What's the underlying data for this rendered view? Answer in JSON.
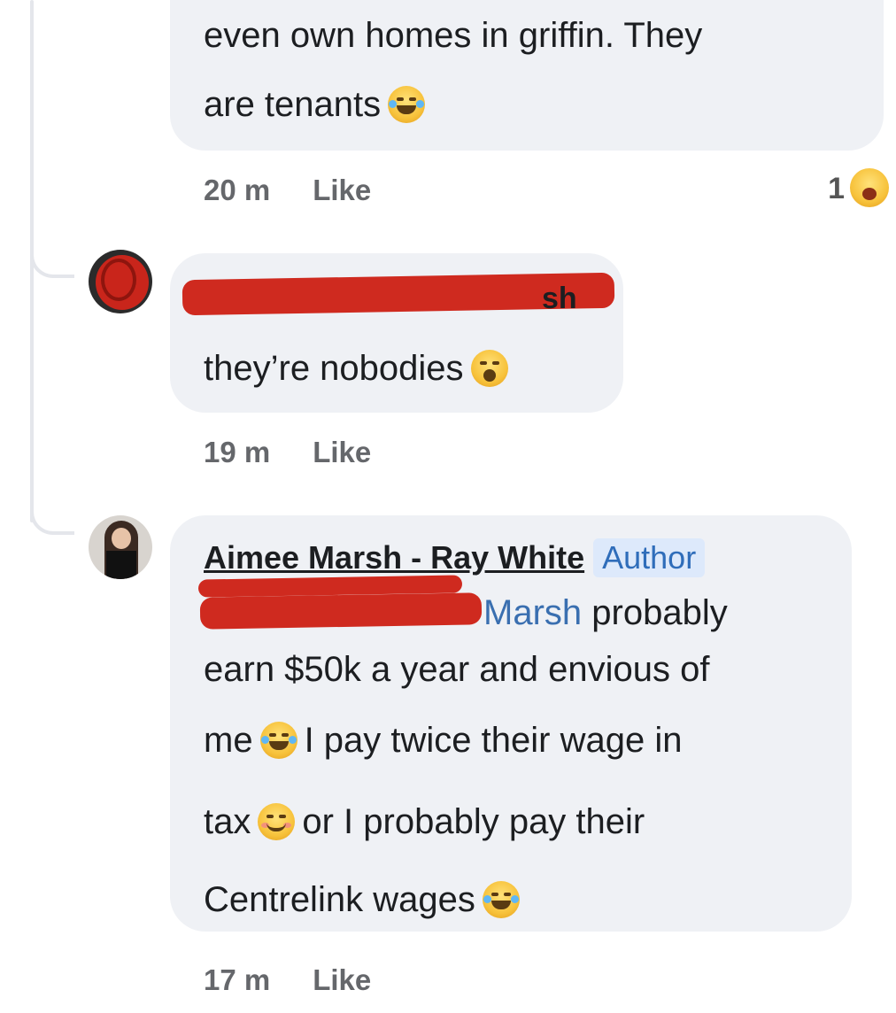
{
  "comment1": {
    "lines": [
      "even own homes in griffin. They",
      "are tenants"
    ],
    "emoji": "laughing-tears-emoji",
    "time": "20 m",
    "like_label": "Like",
    "reaction_count": "1",
    "reaction_emoji": "wow-emoji"
  },
  "comment2": {
    "author_partial": "sh",
    "text": "they’re nobodies",
    "emoji": "yawn-emoji",
    "time": "19 m",
    "like_label": "Like"
  },
  "comment3": {
    "author": "Aimee Marsh - Ray White",
    "badge": "Author",
    "mention": "Marsh",
    "line1_rest": "probably",
    "line2": "earn $50k a year and envious of",
    "line3_a": "me",
    "line3_b": "I pay twice their wage in",
    "line4_a": "tax",
    "line4_b": "or I probably pay their",
    "line5": "Centrelink wages",
    "time": "17 m",
    "like_label": "Like"
  },
  "colors": {
    "bubble": "#eff1f5",
    "redaction": "#cf2a1f",
    "author_badge_bg": "#dde9fb",
    "author_badge_text": "#2f6dba"
  }
}
